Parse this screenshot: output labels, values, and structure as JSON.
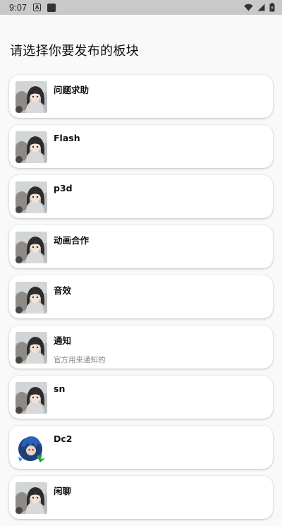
{
  "status_bar": {
    "time": "9:07",
    "notification_letter": "A",
    "icons": [
      "wifi-icon",
      "signal-icon",
      "battery-icon"
    ]
  },
  "page": {
    "heading": "请选择你要发布的板块"
  },
  "sections": [
    {
      "title": "问题求助",
      "description": "",
      "avatar": "girl-avatar"
    },
    {
      "title": "Flash",
      "description": "",
      "avatar": "girl-avatar"
    },
    {
      "title": "p3d",
      "description": "",
      "avatar": "girl-avatar"
    },
    {
      "title": "动画合作",
      "description": "",
      "avatar": "girl-avatar"
    },
    {
      "title": "音效",
      "description": "",
      "avatar": "girl-avatar"
    },
    {
      "title": "通知",
      "description": "官方用来通知的",
      "avatar": "girl-avatar"
    },
    {
      "title": "sn",
      "description": "",
      "avatar": "girl-avatar"
    },
    {
      "title": "Dc2",
      "description": "",
      "avatar": "blue-character-avatar"
    },
    {
      "title": "闲聊",
      "description": "",
      "avatar": "girl-avatar"
    }
  ],
  "colors": {
    "background": "#f9f9f9",
    "status_bar": "#c9c9c9",
    "card": "#ffffff",
    "description": "#8a8a8a"
  }
}
